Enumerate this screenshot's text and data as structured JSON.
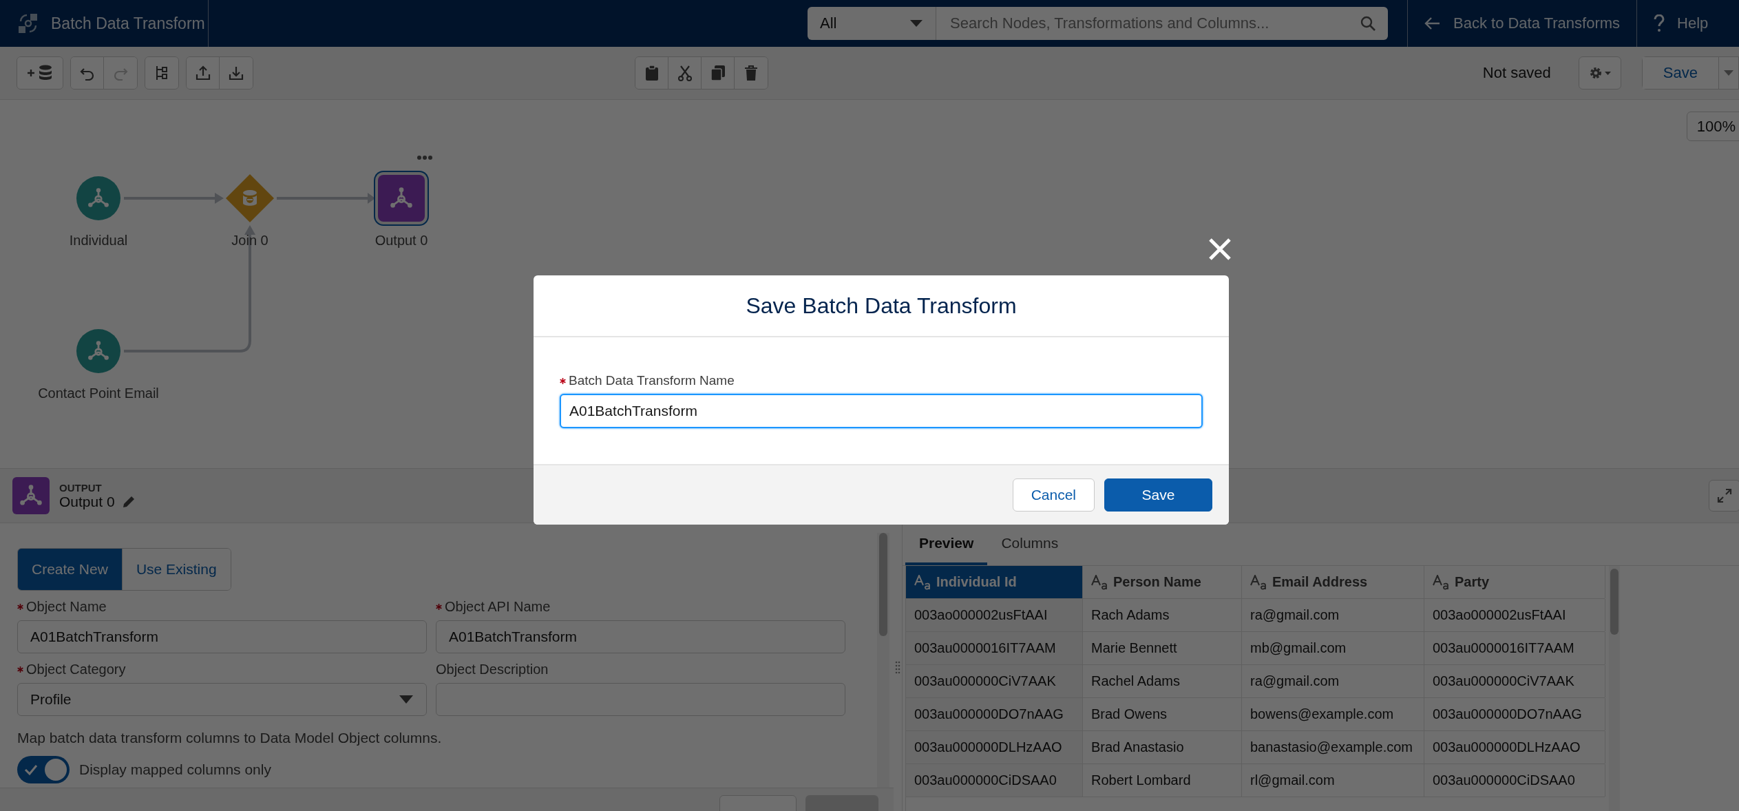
{
  "app_header": {
    "title": "Batch Data Transform",
    "scope_select": {
      "value": "All"
    },
    "search": {
      "placeholder": "Search Nodes, Transformations and Columns..."
    },
    "back_link": "Back to Data Transforms",
    "help": "Help"
  },
  "toolbar": {
    "left_groups": [
      [
        {
          "kind": "add-data",
          "disabled": false
        }
      ],
      [
        {
          "kind": "undo",
          "disabled": false
        },
        {
          "kind": "redo",
          "disabled": true
        }
      ],
      [
        {
          "kind": "layout",
          "disabled": false
        }
      ],
      [
        {
          "kind": "upload",
          "disabled": false
        },
        {
          "kind": "download",
          "disabled": false
        }
      ]
    ],
    "center_group": [
      {
        "kind": "paste",
        "disabled": false
      },
      {
        "kind": "cut",
        "disabled": false
      },
      {
        "kind": "copy",
        "disabled": false
      },
      {
        "kind": "delete",
        "disabled": false
      }
    ],
    "status": "Not saved",
    "save_button": "Save"
  },
  "canvas": {
    "zoom": "100%",
    "nodes": [
      {
        "label": "Individual",
        "kind": "source",
        "selected": false
      },
      {
        "label": "Join 0",
        "kind": "join",
        "selected": false
      },
      {
        "label": "Output 0",
        "kind": "output",
        "selected": true
      },
      {
        "label": "Contact Point Email",
        "kind": "source",
        "selected": false
      }
    ]
  },
  "node_panel": {
    "type_label": "OUTPUT",
    "name": "Output 0",
    "mode_tabs": [
      {
        "label": "Create New",
        "selected": true
      },
      {
        "label": "Use Existing",
        "selected": false
      }
    ],
    "fields": [
      {
        "label": "Object Name",
        "required": true,
        "kind": "text",
        "value": "A01BatchTransform"
      },
      {
        "label": "Object API Name",
        "required": true,
        "kind": "text",
        "value": "A01BatchTransform"
      },
      {
        "label": "Object Category",
        "required": true,
        "kind": "select",
        "value": "Profile"
      },
      {
        "label": "Object Description",
        "required": false,
        "kind": "text"
      }
    ],
    "mapping_note": "Map batch data transform columns to Data Model Object columns.",
    "toggle": {
      "label": "Display mapped columns only",
      "on": true
    }
  },
  "preview": {
    "tabs": [
      {
        "label": "Preview",
        "selected": true
      },
      {
        "label": "Columns",
        "selected": false
      }
    ],
    "table": {
      "columns": [
        {
          "label": "Individual Id",
          "selected": true
        },
        {
          "label": "Person Name",
          "selected": false
        },
        {
          "label": "Email Address",
          "selected": false
        },
        {
          "label": "Party",
          "selected": false
        }
      ],
      "rows": [
        [
          "003ao000002usFtAAI",
          "Rach Adams",
          "ra@gmail.com",
          "003ao000002usFtAAI"
        ],
        [
          "003au0000016IT7AAM",
          "Marie Bennett",
          "mb@gmail.com",
          "003au0000016IT7AAM"
        ],
        [
          "003au000000CiV7AAK",
          "Rachel Adams",
          "ra@gmail.com",
          "003au000000CiV7AAK"
        ],
        [
          "003au000000DO7nAAG",
          "Brad Owens",
          "bowens@example.com",
          "003au000000DO7nAAG"
        ],
        [
          "003au000000DLHzAAO",
          "Brad Anastasio",
          "banastasio@example.com",
          "003au000000DLHzAAO"
        ],
        [
          "003au000000CiDSAA0",
          "Robert Lombard",
          "rl@gmail.com",
          "003au000000CiDSAA0"
        ]
      ]
    }
  },
  "modal": {
    "title": "Save Batch Data Transform",
    "field": {
      "label": "Batch Data Transform Name",
      "required": true,
      "value": "A01BatchTransform"
    },
    "buttons": [
      {
        "label": "Cancel",
        "kind": "neutral"
      },
      {
        "label": "Save",
        "kind": "brand"
      }
    ]
  }
}
